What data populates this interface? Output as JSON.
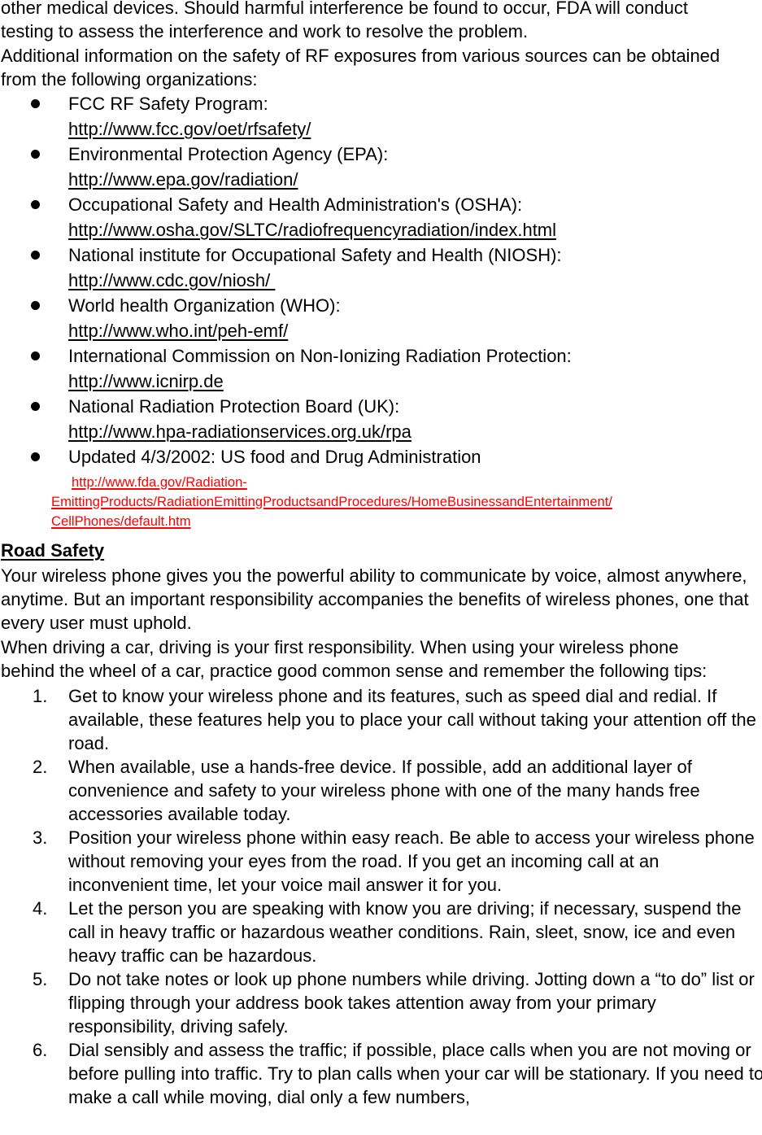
{
  "intro": {
    "paragraphs": [
      "other medical devices. Should harmful interference be found to occur, FDA will conduct testing to assess the interference and work to resolve the problem.",
      "Additional information on the safety of RF exposures from various sources can be obtained from the following organizations:"
    ]
  },
  "organizations": [
    {
      "name": "FCC RF Safety Program:",
      "url": "http://www.fcc.gov/oet/rfsafety/"
    },
    {
      "name": "Environmental Protection Agency (EPA):",
      "url": "http://www.epa.gov/radiation/"
    },
    {
      "name": "Occupational Safety and Health Administration's (OSHA):",
      "url": "http://www.osha.gov/SLTC/radiofrequencyradiation/index.html"
    },
    {
      "name": "National institute for Occupational Safety and Health (NIOSH):",
      "url": "http://www.cdc.gov/niosh/ "
    },
    {
      "name": "World health Organization (WHO):",
      "url": "http://www.who.int/peh-emf/"
    },
    {
      "name": "International Commission on Non-Ionizing Radiation Protection:",
      "url": "http://www.icnirp.de"
    },
    {
      "name": "National Radiation Protection Board (UK):",
      "url": "http://www.hpa-radiationservices.org.uk/rpa"
    },
    {
      "name": "Updated 4/3/2002: US food and Drug Administration",
      "url_line1": "http://www.fda.gov/Radiation-",
      "url_line2": "EmittingProducts/RadiationEmittingProductsandProcedures/HomeBusinessandEntertainment/",
      "url_line3": "CellPhones/default.htm"
    }
  ],
  "colors": {
    "text": "#000000",
    "fda_link": "#ff0000",
    "background": "#ffffff"
  },
  "road_safety": {
    "heading": "Road Safety",
    "paragraphs": [
      "Your wireless phone gives you the powerful ability to communicate by voice, almost anywhere, anytime. But an important responsibility accompanies the benefits of wireless phones, one that every user must uphold.",
      "When driving a car, driving is your first responsibility. When using your wireless phone behind the wheel of a car, practice good common sense and remember the following tips:"
    ],
    "tips": [
      {
        "number": "1.",
        "text": "Get to know your wireless phone and its features, such as speed dial and redial. If available, these features help you to place your call without taking your attention off the road."
      },
      {
        "number": "2.",
        "text": "When available, use a hands-free device. If possible, add an additional layer of convenience and safety to your wireless phone with one of the many hands free accessories available today."
      },
      {
        "number": "3.",
        "text": "Position your wireless phone within easy reach. Be able to access your wireless phone without removing your eyes from the road. If you get an incoming call at an inconvenient time, let your voice mail answer it for you."
      },
      {
        "number": "4.",
        "text": "Let the person you are speaking with know you are driving; if necessary, suspend the call in heavy traffic or hazardous weather conditions. Rain, sleet, snow, ice and even heavy traffic can be hazardous."
      },
      {
        "number": "5.",
        "text": "Do not take notes or look up phone numbers while driving. Jotting down a “to do” list or flipping through your address book takes attention away from your primary responsibility, driving safely."
      },
      {
        "number": "6.",
        "text": "Dial sensibly and assess the traffic; if possible, place calls when you are not moving or before pulling into traffic. Try to plan calls when your car will be stationary. If you need to make a call while moving, dial only a few numbers,"
      }
    ]
  }
}
